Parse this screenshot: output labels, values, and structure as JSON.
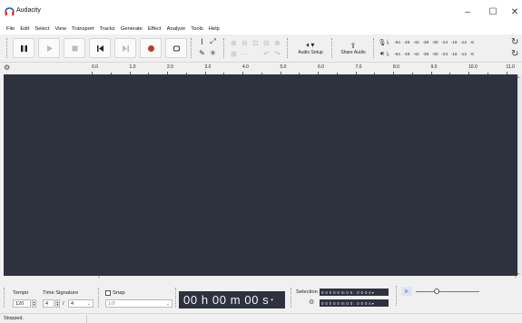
{
  "window": {
    "title": "Audacity",
    "minimize_glyph": "–",
    "maximize_glyph": "☐",
    "close_glyph": "✕"
  },
  "menu": [
    "File",
    "Edit",
    "Select",
    "View",
    "Transport",
    "Tracks",
    "Generate",
    "Effect",
    "Analyze",
    "Tools",
    "Help"
  ],
  "toolbar": {
    "audio_setup_label": "Audio Setup",
    "share_audio_label": "Share Audio",
    "recording_meter_ticks": [
      "-54",
      "-48",
      "-42",
      "-36",
      "-30",
      "-24",
      "-18",
      "-12",
      "-6"
    ],
    "playback_meter_ticks": [
      "-54",
      "-48",
      "-42",
      "-36",
      "-30",
      "-24",
      "-18",
      "-12",
      "-6"
    ],
    "meter_lr": [
      "L",
      "R"
    ],
    "colors": {
      "record": "#c0392b",
      "transport": "#222222",
      "dimmed": "#bbbbbb"
    }
  },
  "ruler": {
    "ticks": [
      "0.0",
      "1.0",
      "2.0",
      "3.0",
      "4.0",
      "5.0",
      "6.0",
      "7.0",
      "8.0",
      "9.0",
      "10.0",
      "11.0"
    ]
  },
  "bottom": {
    "tempo_label": "Tempo",
    "time_signature_label": "Time Signature",
    "tempo_value": "120",
    "time_sig_numerator": "4",
    "time_sig_slash": "/",
    "time_sig_denominator": "4",
    "snap_label": "Snap",
    "snap_value": "1/8",
    "time_display": "00 h 00 m 00 s",
    "selection_label": "Selection",
    "selection_start": "0 0 h 0 0 m 0 0 . 0 0 0 s",
    "selection_end": "0 0 h 0 0 m 0 0 . 0 0 0 s",
    "track_area_color": "#2e323f"
  },
  "status": {
    "text": "Stopped."
  }
}
